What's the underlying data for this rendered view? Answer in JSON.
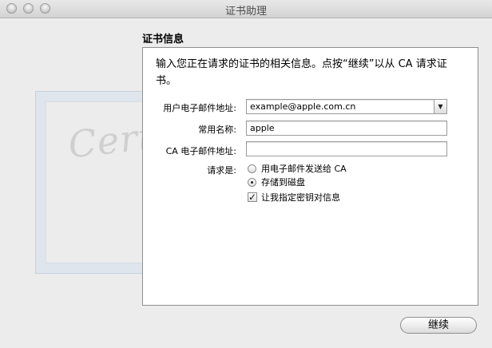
{
  "window": {
    "title": "证书助理"
  },
  "section": {
    "title": "证书信息"
  },
  "intro": "输入您正在请求的证书的相关信息。点按“继续”以从 CA 请求证书。",
  "form": {
    "email_label": "用户电子邮件地址:",
    "email_value": "example@apple.com.cn",
    "name_label": "常用名称:",
    "name_value": "apple",
    "ca_email_label": "CA 电子邮件地址:",
    "ca_email_value": "",
    "request_label": "请求是:",
    "option_email": "用电子邮件发送给 CA",
    "option_disk": "存储到磁盘",
    "option_keypair": "让我指定密钥对信息",
    "option_email_selected": false,
    "option_disk_selected": true,
    "option_keypair_checked": true
  },
  "buttons": {
    "continue_label": "继续"
  },
  "watermark": {
    "text": "Certificate"
  }
}
